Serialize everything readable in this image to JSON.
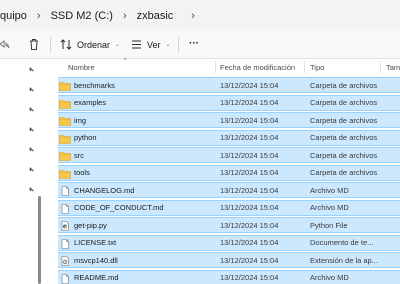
{
  "address": {
    "crumbs": [
      "quipo",
      "SSD M2 (C:)",
      "zxbasic"
    ]
  },
  "toolbar": {
    "sort_label": "Ordenar",
    "view_label": "Ver",
    "more_label": "···"
  },
  "columns": {
    "name": "Nombre",
    "date": "Fecha de modificación",
    "type": "Tipo",
    "size": "Tama"
  },
  "files": [
    {
      "name": "benchmarks",
      "date": "13/12/2024 15:04",
      "type": "Carpeta de archivos",
      "icon": "folder-icon"
    },
    {
      "name": "examples",
      "date": "13/12/2024 15:04",
      "type": "Carpeta de archivos",
      "icon": "folder-icon"
    },
    {
      "name": "img",
      "date": "13/12/2024 15:04",
      "type": "Carpeta de archivos",
      "icon": "folder-icon"
    },
    {
      "name": "python",
      "date": "13/12/2024 15:04",
      "type": "Carpeta de archivos",
      "icon": "folder-icon"
    },
    {
      "name": "src",
      "date": "13/12/2024 15:04",
      "type": "Carpeta de archivos",
      "icon": "folder-icon"
    },
    {
      "name": "tools",
      "date": "13/12/2024 15:04",
      "type": "Carpeta de archivos",
      "icon": "folder-icon"
    },
    {
      "name": "CHANGELOG.md",
      "date": "13/12/2024 15:04",
      "type": "Archivo MD",
      "icon": "document-icon"
    },
    {
      "name": "CODE_OF_CONDUCT.md",
      "date": "13/12/2024 15:04",
      "type": "Archivo MD",
      "icon": "document-icon"
    },
    {
      "name": "get-pip.py",
      "date": "13/12/2024 15:04",
      "type": "Python File",
      "icon": "python-file-icon"
    },
    {
      "name": "LICENSE.txt",
      "date": "13/12/2024 15:04",
      "type": "Documento de te...",
      "icon": "document-icon"
    },
    {
      "name": "msvcp140.dll",
      "date": "13/12/2024 15:04",
      "type": "Extensión de la ap...",
      "icon": "dll-file-icon"
    },
    {
      "name": "README.md",
      "date": "13/12/2024 15:04",
      "type": "Archivo MD",
      "icon": "document-icon"
    }
  ],
  "colors": {
    "selection": "#cce8ff",
    "selection_border": "#99d1ff",
    "folder": "#f8c74a"
  }
}
